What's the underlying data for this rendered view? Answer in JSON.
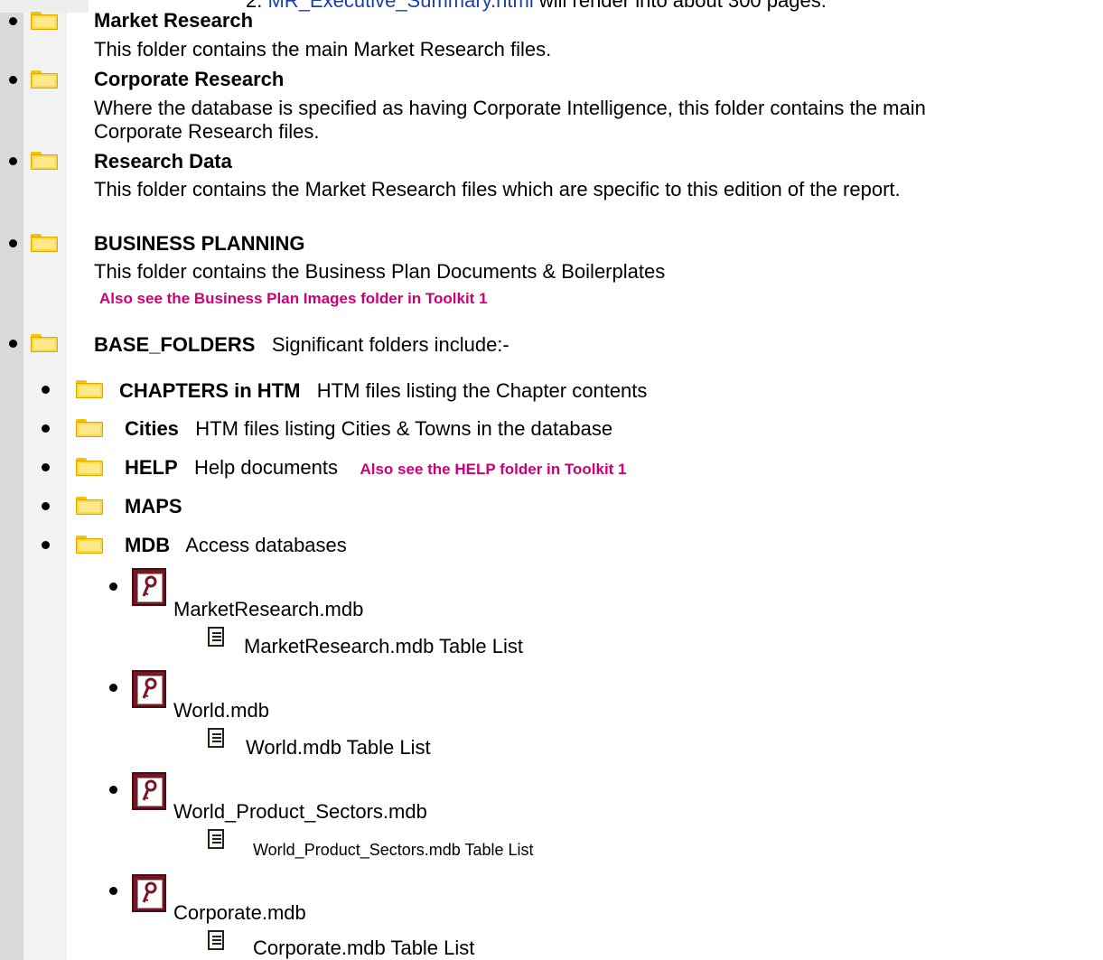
{
  "top_note": {
    "number": "2.",
    "link": "MR_Executive_Summary.html",
    "rest": "will render into about 300 pages."
  },
  "items": [
    {
      "title": "Market Research",
      "desc": "This folder contains the main Market Research files."
    },
    {
      "title": "Corporate Research",
      "desc1": "Where the database is specified as having Corporate Intelligence, this folder contains the main",
      "desc2": "Corporate Research files."
    },
    {
      "title": "Research Data",
      "desc": "This folder contains the Market Research files which are specific to this edition of the report."
    },
    {
      "title": "BUSINESS PLANNING",
      "desc": "This folder contains the Business Plan Documents & Boilerplates",
      "note": "Also see the Business Plan Images folder in Toolkit 1"
    },
    {
      "title": "BASE_FOLDERS",
      "desc": "Significant folders include:-"
    }
  ],
  "subfolders": [
    {
      "title": "CHAPTERS in HTM",
      "desc": "HTM files listing the Chapter contents"
    },
    {
      "title": "Cities",
      "desc": "HTM files listing Cities & Towns in the database"
    },
    {
      "title": "HELP",
      "desc": "Help documents",
      "note": "Also see the HELP folder in Toolkit 1"
    },
    {
      "title": "MAPS",
      "desc": ""
    },
    {
      "title": "MDB",
      "desc": "Access databases"
    }
  ],
  "databases": [
    {
      "file": "MarketResearch.mdb",
      "table_list": "MarketResearch.mdb Table List"
    },
    {
      "file": "World.mdb",
      "table_list": "World.mdb Table List"
    },
    {
      "file": "World_Product_Sectors.mdb",
      "table_list": "World_Product_Sectors.mdb Table List"
    },
    {
      "file": "Corporate.mdb",
      "table_list": "Corporate.mdb Table List"
    }
  ],
  "icons": {
    "folder": "folder-icon",
    "database": "access-database-icon",
    "document": "document-icon"
  },
  "colors": {
    "highlight": "#cc0077",
    "link": "#1b3fb3",
    "folder": "#ffd83d"
  }
}
